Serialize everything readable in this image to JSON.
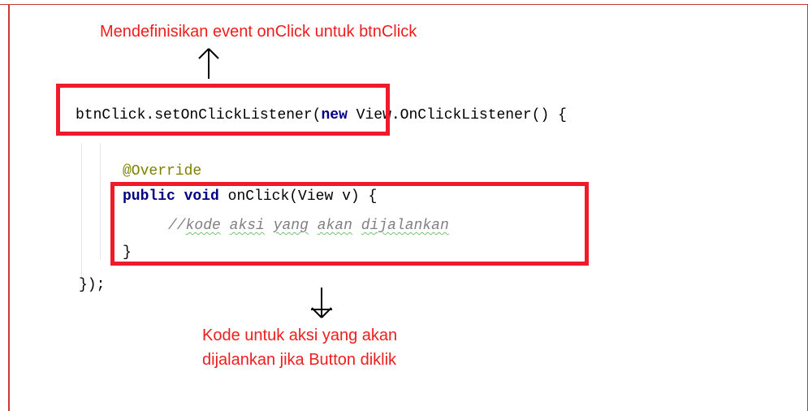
{
  "annotations": {
    "top": "Mendefinisikan event onClick untuk btnClick",
    "bottom_line_1": "Kode untuk aksi yang akan",
    "bottom_line_2": "dijalankan jika Button diklik"
  },
  "code": {
    "line1_obj": "btnClick.setOnClickListener",
    "line1_paren": "(",
    "line1_new": "new",
    "line1_rest": " View.OnClickListener() {",
    "line2_annotation": "@Override",
    "line3_public": "public",
    "line3_space1": " ",
    "line3_void": "void",
    "line3_rest": " onClick(View v) {",
    "line4_prefix": "//",
    "line4_word1": "kode",
    "line4_space1": " ",
    "line4_word2": "aksi",
    "line4_space2": " ",
    "line4_word3": "yang",
    "line4_space3": " ",
    "line4_word4": "akan",
    "line4_space4": " ",
    "line4_word5": "dijalankan",
    "line5_close": "}",
    "line6_close": "});"
  },
  "colors": {
    "annotation_red": "#f01d1d",
    "box_red": "#ef1b2a",
    "code_keyword": "#000080",
    "code_annotation": "#808000",
    "code_comment": "#808080"
  },
  "icons": {
    "top_arrow": "arrow-up-icon",
    "bottom_arrow": "arrow-down-icon"
  }
}
